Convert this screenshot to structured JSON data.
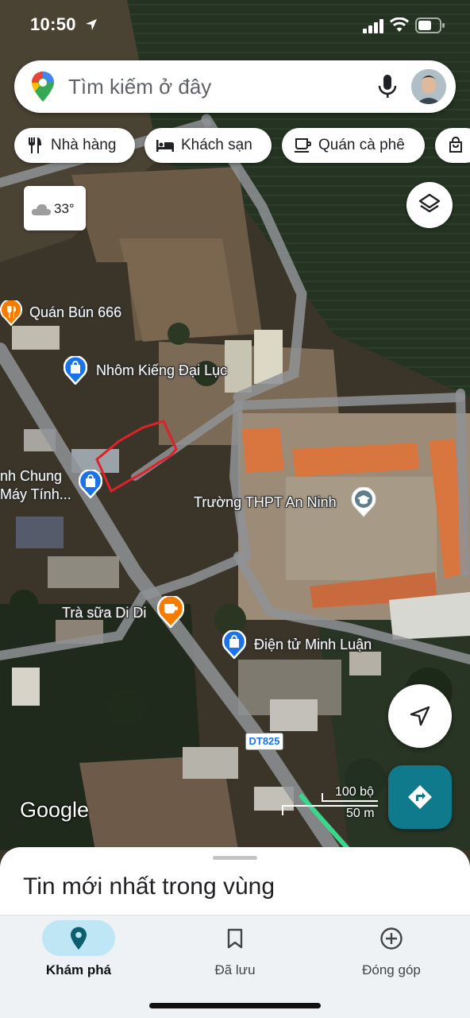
{
  "status_bar": {
    "time": "10:50"
  },
  "search": {
    "placeholder": "Tìm kiếm ở đây"
  },
  "chips": [
    {
      "label": "Nhà hàng",
      "icon": "restaurant-icon"
    },
    {
      "label": "Khách sạn",
      "icon": "hotel-icon"
    },
    {
      "label": "Quán cà phê",
      "icon": "coffee-icon"
    },
    {
      "label": "",
      "icon": "shopping-icon"
    }
  ],
  "weather": {
    "temp": "33°",
    "icon": "cloud-icon"
  },
  "map_labels": {
    "quan_bun": "Quán Bún 666",
    "nhom_kinh": "Nhôm Kiếng Đại Lục",
    "anh_chung_1": "nh Chung",
    "anh_chung_2": "Máy Tính...",
    "truong": "Trường THPT An Ninh",
    "tra_sua": "Trà sữa Di Di",
    "dien_tu": "Điện tử Minh Luận",
    "road": "DT825",
    "google": "Google",
    "scale_ft": "100 bộ",
    "scale_m": "50 m"
  },
  "sheet": {
    "title": "Tin mới nhất trong vùng"
  },
  "nav": {
    "explore": "Khám phá",
    "saved": "Đã lưu",
    "contribute": "Đóng góp"
  },
  "colors": {
    "accent": "#0f7a8c",
    "active_pill": "#bfe6f4",
    "poi_blue": "#1a73e8",
    "poi_orange": "#f57c00",
    "annotation": "#e0202a"
  }
}
